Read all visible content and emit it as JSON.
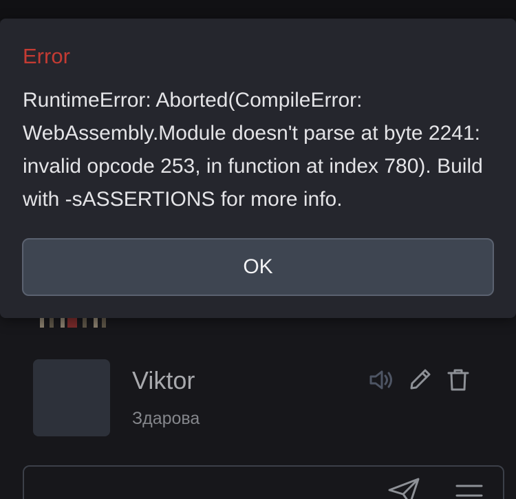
{
  "dialog": {
    "title": "Error",
    "message": "RuntimeError: Aborted(CompileError: WebAssembly.Module doesn't parse at byte 2241: invalid opcode 253, in function at index 780). Build with -sASSERTIONS for more info.",
    "ok_label": "OK"
  },
  "chat_list": {
    "items": [
      {
        "name": "Viktor",
        "preview": "Здарова",
        "actions": [
          "speaker-icon",
          "pencil-icon",
          "trash-icon"
        ]
      }
    ]
  },
  "composer": {
    "icons": [
      "send-icon",
      "menu-icon"
    ]
  },
  "colors": {
    "background": "#17171b",
    "dialog_background": "#25262d",
    "error_title": "#c43b33",
    "button_background": "#3e4551",
    "icon": "#8e9197"
  }
}
